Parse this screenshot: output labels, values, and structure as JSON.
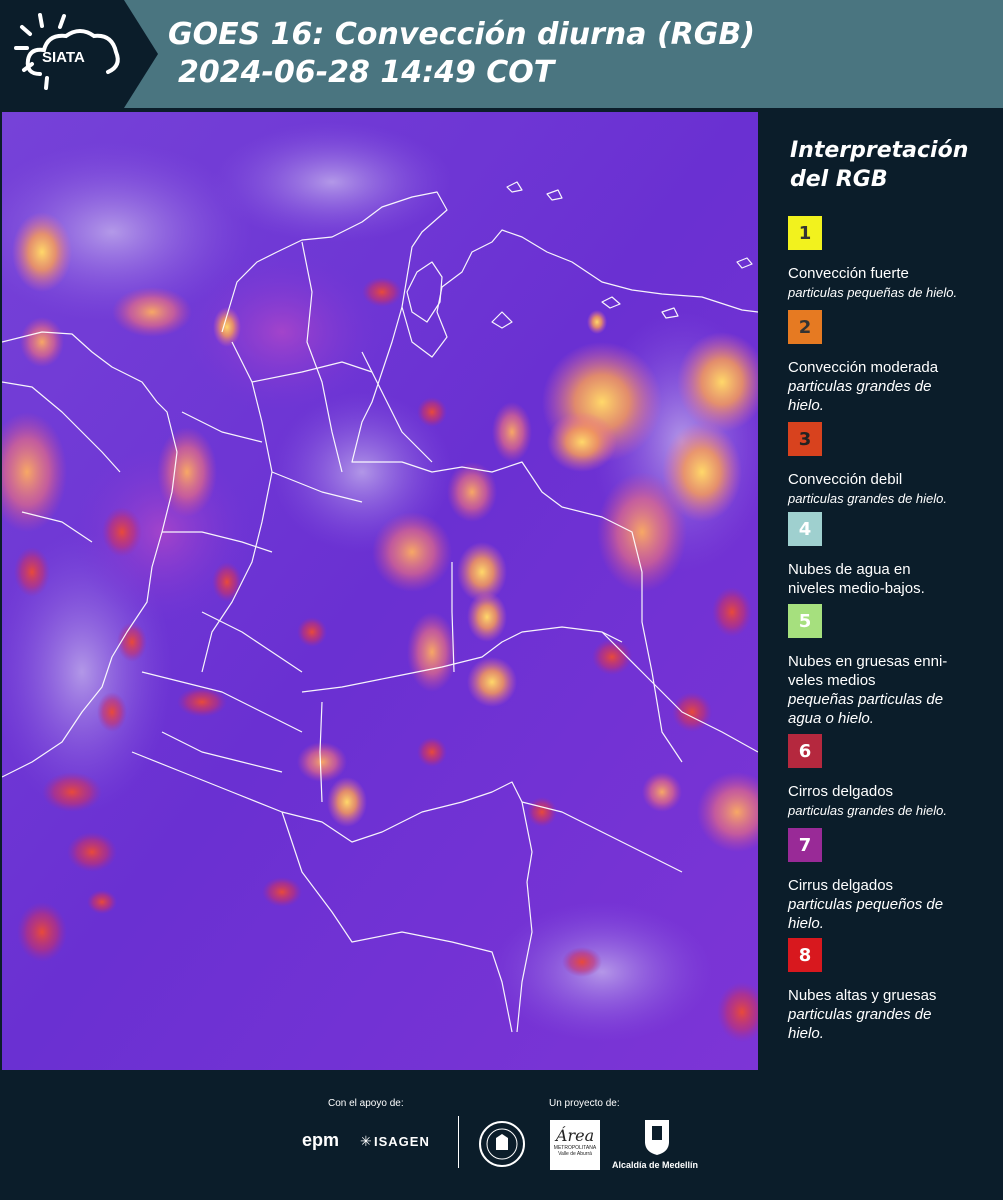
{
  "header": {
    "logo_text": "SIATA",
    "title_line1": "GOES 16: Convección diurna (RGB)",
    "title_line2": "2024-06-28 14:49 COT",
    "bg_color": "#4a7580"
  },
  "legend": {
    "title_line1": "Interpretación",
    "title_line2": "del RGB",
    "items": [
      {
        "num": "1",
        "color": "#f2f21e",
        "title": "Convección fuerte",
        "sub": "particulas pequeñas de hielo."
      },
      {
        "num": "2",
        "color": "#e67a22",
        "title": "Convección moderada",
        "sub": "particulas grandes de hielo."
      },
      {
        "num": "3",
        "color": "#d8421e",
        "title": "Convección debil",
        "sub": "particulas grandes de hielo."
      },
      {
        "num": "4",
        "color": "#9fd0cf",
        "title": "Nubes de agua en niveles medio-bajos.",
        "sub": ""
      },
      {
        "num": "5",
        "color": "#a6e07e",
        "title": "Nubes en gruesas enni-veles medios",
        "sub": "pequeñas particulas de agua o hielo."
      },
      {
        "num": "6",
        "color": "#b5283e",
        "title": "Cirros delgados",
        "sub": "particulas grandes de hielo."
      },
      {
        "num": "7",
        "color": "#992a97",
        "title": "Cirrus delgados",
        "sub": "particulas pequeños de hielo."
      },
      {
        "num": "8",
        "color": "#d8181e",
        "title": "Nubes altas y gruesas",
        "sub": "particulas grandes de hielo."
      }
    ]
  },
  "footer": {
    "support_label": "Con el apoyo de:",
    "project_label": "Un proyecto de:",
    "sponsor1": "epm",
    "sponsor2": "ISAGEN",
    "area_text": "Área",
    "area_sub1": "METROPOLITANA",
    "area_sub2": "Valle de Aburrá",
    "alcaldia": "Alcaldía de Medellín"
  }
}
